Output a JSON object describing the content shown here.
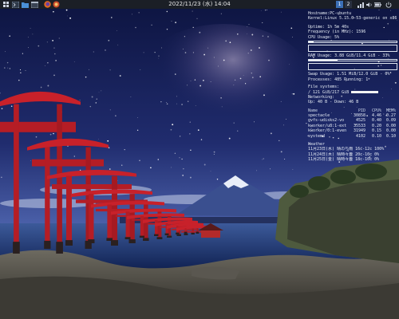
{
  "topbar": {
    "clock": "2022/11/23 (水) 14:04",
    "workspaces": [
      "1",
      "2"
    ],
    "colors": {
      "bar": "#1b1f26",
      "active_ws": "#3b6fb6",
      "inactive_ws": "#2a3140"
    },
    "left_icons": [
      "app-menu-icon",
      "terminal-icon",
      "folder-icon",
      "firefox-icon",
      "window-icon"
    ],
    "right_icons": [
      "network-icon",
      "volume-icon",
      "battery-icon",
      "power-icon"
    ]
  },
  "conky": {
    "hostname": "Hostname:PC-ubuntu",
    "kernel": "Kernel:Linux 5.15.0-53-generic on x86_64",
    "uptime": "Uptime: 1h 5m 40s",
    "frequency": "Frequency (in MHz): 1596",
    "cpu_usage": "CPU Usage: 5%",
    "cpu_usage_fraction": 0.05,
    "ram_usage": "RAM Usage: 3.88 GiB/11.4 GiB - 33%",
    "ram_fraction": 0.33,
    "swap_usage": "Swap Usage: 1.51 MiB/12.0 GiB - 0%",
    "processes": "Processes: 485  Running: 1",
    "file_systems_header": "File systems:",
    "file_systems": "/ 121 GiB/217 GiB",
    "fs_fraction": 0.56,
    "networking_header": "Networking:",
    "networking": "Up: 40 B  - Down: 46 B",
    "process_header": {
      "name": "Name",
      "pid": "PID",
      "cpu": "CPU%",
      "mem": "MEM%"
    },
    "processes_list": [
      {
        "name": "spectacle",
        "pid": "30858",
        "cpu": "4.46",
        "mem": "0.27"
      },
      {
        "name": "gvfs-udisks2-vo",
        "pid": "4525",
        "cpu": "0.40",
        "mem": "0.09"
      },
      {
        "name": "kworker/u8:1-ext",
        "pid": "35533",
        "cpu": "0.20",
        "mem": "0.00"
      },
      {
        "name": "kworker/0:1-even",
        "pid": "31949",
        "cpu": "0.15",
        "mem": "0.00"
      },
      {
        "name": "systemd",
        "pid": "4102",
        "cpu": "0.10",
        "mem": "0.10"
      }
    ],
    "weather_header": "Weather",
    "weather": [
      "11月23日(水) 晴のち雨 16c-12c 100%",
      "11月24日(木) 晴時々曇 20c-10c 0%",
      "11月25日(金) 晴時々曇 18c-10c 0%"
    ]
  }
}
